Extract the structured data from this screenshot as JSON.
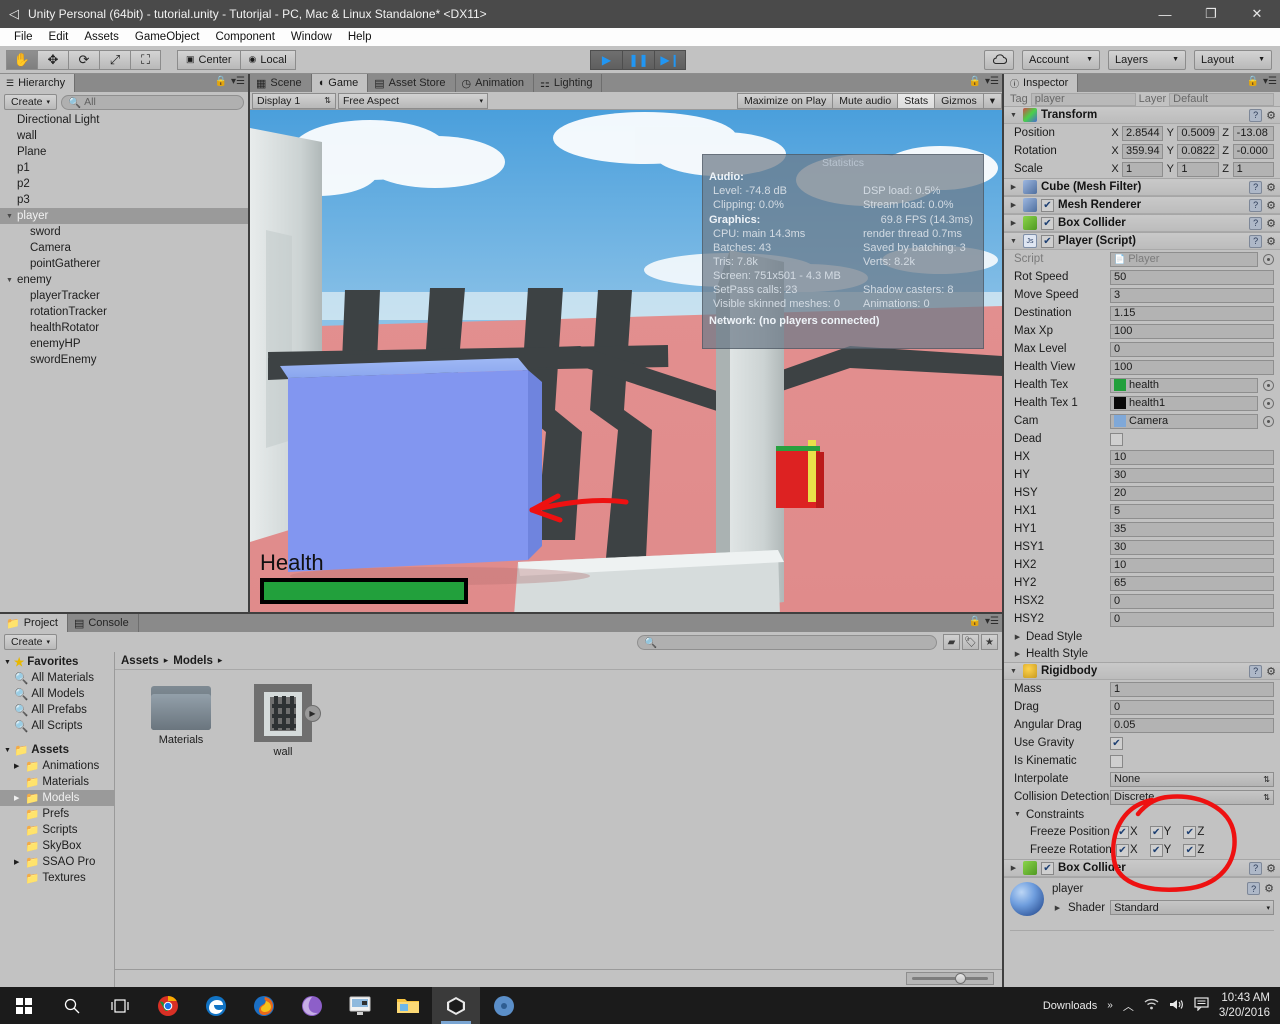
{
  "window": {
    "title": "Unity Personal (64bit) - tutorial.unity - Tutorijal - PC, Mac & Linux Standalone* <DX11>",
    "app_icon": "unity-logo-icon",
    "minimize": "—",
    "maximize": "❐",
    "close": "✕"
  },
  "menubar": {
    "items": [
      "File",
      "Edit",
      "Assets",
      "GameObject",
      "Component",
      "Window",
      "Help"
    ]
  },
  "toolbar": {
    "transform_tools": [
      "hand-tool",
      "move-tool",
      "rotate-tool",
      "scale-tool",
      "rect-tool"
    ],
    "pivot_mode": "Center",
    "pivot_rotation": "Local",
    "play": "▶",
    "pause": "❚❚",
    "step": "▶❙",
    "cloud_label": "cloud-icon",
    "account": "Account",
    "layers": "Layers",
    "layout": "Layout"
  },
  "hierarchy": {
    "tab": "Hierarchy",
    "create_button": "Create",
    "search_placeholder": "All",
    "items": [
      {
        "name": "Directional Light",
        "depth": 0,
        "arrow": "",
        "selected": false
      },
      {
        "name": "wall",
        "depth": 0,
        "arrow": "",
        "selected": false
      },
      {
        "name": "Plane",
        "depth": 0,
        "arrow": "",
        "selected": false
      },
      {
        "name": "p1",
        "depth": 0,
        "arrow": "",
        "selected": false
      },
      {
        "name": "p2",
        "depth": 0,
        "arrow": "",
        "selected": false
      },
      {
        "name": "p3",
        "depth": 0,
        "arrow": "",
        "selected": false
      },
      {
        "name": "player",
        "depth": 0,
        "arrow": "▼",
        "selected": true
      },
      {
        "name": "sword",
        "depth": 1,
        "arrow": "",
        "selected": false
      },
      {
        "name": "Camera",
        "depth": 1,
        "arrow": "",
        "selected": false
      },
      {
        "name": "pointGatherer",
        "depth": 1,
        "arrow": "",
        "selected": false
      },
      {
        "name": "enemy",
        "depth": 0,
        "arrow": "▼",
        "selected": false
      },
      {
        "name": "playerTracker",
        "depth": 1,
        "arrow": "",
        "selected": false
      },
      {
        "name": "rotationTracker",
        "depth": 1,
        "arrow": "",
        "selected": false
      },
      {
        "name": "healthRotator",
        "depth": 1,
        "arrow": "",
        "selected": false
      },
      {
        "name": "enemyHP",
        "depth": 1,
        "arrow": "",
        "selected": false
      },
      {
        "name": "swordEnemy",
        "depth": 1,
        "arrow": "",
        "selected": false
      }
    ]
  },
  "gameview": {
    "tabs": [
      {
        "label": "Scene",
        "icon": "grid-icon",
        "selected": false
      },
      {
        "label": "Game",
        "icon": "gamepad-icon",
        "selected": true
      },
      {
        "label": "Asset Store",
        "icon": "store-icon",
        "selected": false
      },
      {
        "label": "Animation",
        "icon": "clock-icon",
        "selected": false
      },
      {
        "label": "Lighting",
        "icon": "sliders-icon",
        "selected": false
      }
    ],
    "display": "Display 1",
    "aspect": "Free Aspect",
    "toggles": [
      {
        "label": "Maximize on Play",
        "on": false
      },
      {
        "label": "Mute audio",
        "on": false
      },
      {
        "label": "Stats",
        "on": true
      },
      {
        "label": "Gizmos",
        "on": false
      }
    ],
    "hud": {
      "health_label": "Health",
      "health_percent": 100,
      "health_color": "#22a03c"
    }
  },
  "statistics": {
    "title": "Statistics",
    "audio_header": "Audio:",
    "audio": [
      {
        "left": "Level: -74.8 dB",
        "right": "DSP load: 0.5%"
      },
      {
        "left": "Clipping: 0.0%",
        "right": "Stream load: 0.0%"
      }
    ],
    "graphics_header": "Graphics:",
    "fps": "69.8 FPS (14.3ms)",
    "graphics": [
      {
        "left": "CPU: main 14.3ms",
        "right": "render thread 0.7ms"
      },
      {
        "left": "Batches: 43",
        "right": "Saved by batching: 3"
      },
      {
        "left": "Tris: 7.8k",
        "right": "Verts: 8.2k"
      },
      {
        "left": "Screen: 751x501 - 4.3 MB",
        "right": ""
      },
      {
        "left": "SetPass calls: 23",
        "right": "Shadow casters: 8"
      },
      {
        "left": "Visible skinned meshes: 0",
        "right": "Animations: 0"
      }
    ],
    "network": "Network: (no players connected)"
  },
  "inspector": {
    "tab": "Inspector",
    "tag_label": "Tag",
    "tag_value": "player",
    "layer_label": "Layer",
    "layer_value": "Default",
    "transform": {
      "title": "Transform",
      "rows": [
        {
          "label": "Position",
          "x": "2.8544",
          "y": "0.5009",
          "z": "-13.08"
        },
        {
          "label": "Rotation",
          "x": "359.94",
          "y": "0.0822",
          "z": "-0.000"
        },
        {
          "label": "Scale",
          "x": "1",
          "y": "1",
          "z": "1"
        }
      ]
    },
    "components": [
      {
        "title": "Cube (Mesh Filter)",
        "checkbox": null,
        "icon": "mesh-filter-icon",
        "expanded": false
      },
      {
        "title": "Mesh Renderer",
        "checkbox": true,
        "icon": "mesh-renderer-icon",
        "expanded": false
      },
      {
        "title": "Box Collider",
        "checkbox": true,
        "icon": "box-collider-icon",
        "expanded": false
      }
    ],
    "player_script": {
      "title": "Player (Script)",
      "enabled": true,
      "script_label": "Script",
      "script_value": "Player",
      "fields": [
        {
          "label": "Rot Speed",
          "value": "50",
          "type": "text"
        },
        {
          "label": "Move Speed",
          "value": "3",
          "type": "text"
        },
        {
          "label": "Destination",
          "value": "1.15",
          "type": "text"
        },
        {
          "label": "Max Xp",
          "value": "100",
          "type": "text"
        },
        {
          "label": "Max Level",
          "value": "0",
          "type": "text"
        },
        {
          "label": "Health View",
          "value": "100",
          "type": "text"
        },
        {
          "label": "Health Tex",
          "value": "health",
          "type": "object",
          "swatch": "#22a03c"
        },
        {
          "label": "Health Tex 1",
          "value": "health1",
          "type": "object",
          "swatch": "#0a0a0a"
        },
        {
          "label": "Cam",
          "value": "Camera",
          "type": "object",
          "swatch": "#7fa8d8"
        },
        {
          "label": "Dead",
          "value": "",
          "type": "checkbox",
          "checked": false
        },
        {
          "label": "HX",
          "value": "10",
          "type": "text"
        },
        {
          "label": "HY",
          "value": "30",
          "type": "text"
        },
        {
          "label": "HSY",
          "value": "20",
          "type": "text"
        },
        {
          "label": "HX1",
          "value": "5",
          "type": "text"
        },
        {
          "label": "HY1",
          "value": "35",
          "type": "text"
        },
        {
          "label": "HSY1",
          "value": "30",
          "type": "text"
        },
        {
          "label": "HX2",
          "value": "10",
          "type": "text"
        },
        {
          "label": "HY2",
          "value": "65",
          "type": "text"
        },
        {
          "label": "HSX2",
          "value": "0",
          "type": "text"
        },
        {
          "label": "HSY2",
          "value": "0",
          "type": "text"
        }
      ],
      "foldouts": [
        "Dead Style",
        "Health Style"
      ]
    },
    "rigidbody": {
      "title": "Rigidbody",
      "fields": [
        {
          "label": "Mass",
          "value": "1",
          "type": "text"
        },
        {
          "label": "Drag",
          "value": "0",
          "type": "text"
        },
        {
          "label": "Angular Drag",
          "value": "0.05",
          "type": "text"
        },
        {
          "label": "Use Gravity",
          "value": "",
          "type": "checkbox",
          "checked": true
        },
        {
          "label": "Is Kinematic",
          "value": "",
          "type": "checkbox",
          "checked": false
        },
        {
          "label": "Interpolate",
          "value": "None",
          "type": "select"
        },
        {
          "label": "Collision Detection",
          "value": "Discrete",
          "type": "select"
        }
      ],
      "constraints_label": "Constraints",
      "freeze_position_label": "Freeze Position",
      "freeze_rotation_label": "Freeze Rotation",
      "axes": [
        "X",
        "Y",
        "Z"
      ],
      "freeze_position": [
        true,
        true,
        true
      ],
      "freeze_rotation": [
        true,
        true,
        true
      ]
    },
    "box_collider_bottom": {
      "title": "Box Collider",
      "checked": true
    },
    "material": {
      "name": "player",
      "shader_label": "Shader",
      "shader_value": "Standard"
    }
  },
  "project": {
    "tabs": [
      {
        "label": "Project",
        "selected": true
      },
      {
        "label": "Console",
        "selected": false
      }
    ],
    "create_button": "Create",
    "search_placeholder": "",
    "favorites_label": "Favorites",
    "favorites": [
      "All Materials",
      "All Models",
      "All Prefabs",
      "All Scripts"
    ],
    "assets_label": "Assets",
    "folders": [
      {
        "name": "Animations",
        "arrow": "▶",
        "selected": false
      },
      {
        "name": "Materials",
        "arrow": "",
        "selected": false
      },
      {
        "name": "Models",
        "arrow": "▶",
        "selected": true
      },
      {
        "name": "Prefs",
        "arrow": "",
        "selected": false
      },
      {
        "name": "Scripts",
        "arrow": "",
        "selected": false
      },
      {
        "name": "SkyBox",
        "arrow": "",
        "selected": false
      },
      {
        "name": "SSAO Pro",
        "arrow": "▶",
        "selected": false
      },
      {
        "name": "Textures",
        "arrow": "",
        "selected": false
      }
    ],
    "breadcrumb": [
      "Assets",
      "Models"
    ],
    "items": [
      {
        "name": "Materials",
        "kind": "folder"
      },
      {
        "name": "wall",
        "kind": "model"
      }
    ]
  },
  "taskbar": {
    "icons": [
      "start-icon",
      "search-icon",
      "taskview-icon",
      "chrome-icon",
      "edge-icon",
      "firefox-icon",
      "bittorrent-icon",
      "camtasia-icon",
      "explorer-icon",
      "unity-icon",
      "unity-hub-icon"
    ],
    "tray_text": "Downloads",
    "overflow": "»",
    "tray_icons": [
      "chevron-up-icon",
      "wifi-icon",
      "volume-icon",
      "notifications-icon"
    ],
    "time": "10:43 AM",
    "date": "3/20/2016"
  },
  "annotations": {
    "arrow_color": "#ee1111",
    "circle_color": "#ee1111"
  }
}
